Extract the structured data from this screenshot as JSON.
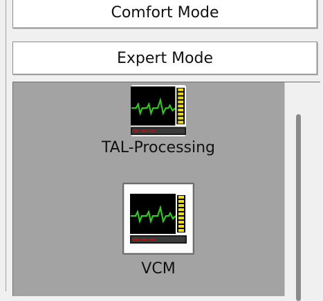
{
  "buttons": {
    "comfort_label": "Comfort Mode",
    "expert_label": "Expert Mode"
  },
  "tiles": [
    {
      "label": "TAL-Processing",
      "icon": "monitor-waveform-icon",
      "selected": false
    },
    {
      "label": "VCM",
      "icon": "monitor-waveform-icon",
      "selected": true
    }
  ],
  "colors": {
    "panel_background": "#a3a3a3",
    "waveform": "#22e000",
    "level_bar": "#f0e000",
    "indicator": "#e00000",
    "screen": "#000000"
  }
}
